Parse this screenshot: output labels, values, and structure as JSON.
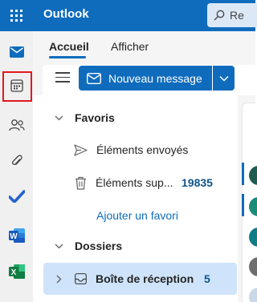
{
  "app": {
    "title": "Outlook"
  },
  "search": {
    "placeholder": "Re"
  },
  "rail": {
    "items": [
      {
        "name": "mail-icon",
        "active": true
      },
      {
        "name": "calendar-icon",
        "highlighted": true
      },
      {
        "name": "people-icon"
      },
      {
        "name": "attachment-icon"
      },
      {
        "name": "todo-icon"
      },
      {
        "name": "word-icon"
      },
      {
        "name": "excel-icon"
      }
    ]
  },
  "ribbon": {
    "tabs": [
      {
        "label": "Accueil",
        "active": true
      },
      {
        "label": "Afficher"
      }
    ],
    "new_message_label": "Nouveau message"
  },
  "folders": {
    "favorites_label": "Favoris",
    "favorites": [
      {
        "label": "Éléments envoyés",
        "icon": "send-icon"
      },
      {
        "label": "Éléments sup...",
        "icon": "trash-icon",
        "count": "19835"
      }
    ],
    "add_favorite_label": "Ajouter un favori",
    "folders_label": "Dossiers",
    "inbox": {
      "label": "Boîte de réception",
      "count": "5"
    }
  },
  "colors": {
    "brand": "#0f6cbd",
    "selected": "#cfe4fa",
    "highlight_box": "#e3171e"
  }
}
